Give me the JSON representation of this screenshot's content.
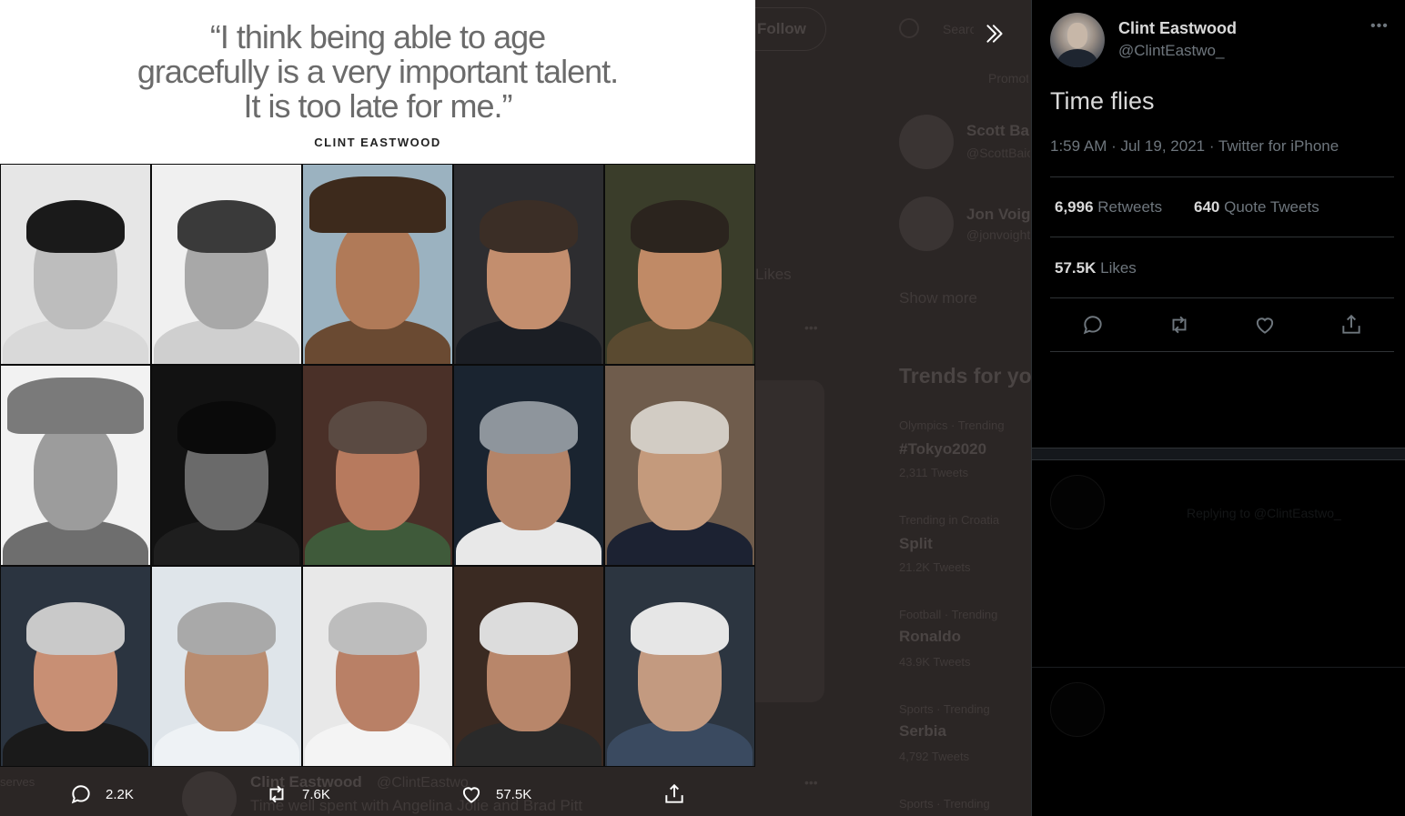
{
  "tweet": {
    "author": {
      "display_name": "Clint Eastwood",
      "handle": "@ClintEastwo_"
    },
    "text": "Time flies",
    "meta": "1:59 AM · Jul 19, 2021 · Twitter for iPhone",
    "retweets": {
      "count": "6,996",
      "label": "Retweets"
    },
    "quote_tweets": {
      "count": "640",
      "label": "Quote Tweets"
    },
    "likes": {
      "count": "57.5K",
      "label": "Likes"
    },
    "more_icon": "•••"
  },
  "media": {
    "quote_line1": "“I think being able to age",
    "quote_line2": "gracefully is a very important talent.",
    "quote_line3": "It is too late for me.”",
    "quote_attribution": "CLINT EASTWOOD",
    "actions": {
      "replies": "2.2K",
      "retweets": "7.6K",
      "likes": "57.5K"
    }
  },
  "background": {
    "follow_label": "Follow",
    "search_placeholder": "Search Twitter",
    "promoted": "Promoted",
    "who_to_follow": [
      {
        "name": "Scott Baio",
        "handle": "@ScottBaio"
      },
      {
        "name": "Jon Voight",
        "handle": "@jonvoight"
      }
    ],
    "show_more": "Show more",
    "likes_partial": "Likes",
    "trends_title": "Trends for you",
    "trends": [
      {
        "context": "Olympics · Trending",
        "name": "#Tokyo2020",
        "count": "2,311 Tweets"
      },
      {
        "context": "Trending in Croatia",
        "name": "Split",
        "count": "21.2K Tweets"
      },
      {
        "context": "Football · Trending",
        "name": "Ronaldo",
        "count": "43.9K Tweets"
      },
      {
        "context": "Sports · Trending",
        "name": "Serbia",
        "count": "4,792 Tweets"
      },
      {
        "context": "Sports · Trending",
        "name": "",
        "count": ""
      }
    ],
    "feed_author": "Clint Eastwood",
    "feed_handle": "@ClintEastwo_",
    "feed_text": "Time well spent with Angelina Jolie and Brad Pitt",
    "feed_left_label": "serves",
    "replying_to": "Replying to @ClintEastwo_"
  },
  "colors": {
    "accent": "#1da1f2",
    "overlay_bg": "#2b2625",
    "detail_bg": "#000000",
    "secondary_text": "#6e767d",
    "primary_text": "#d9d9d9"
  }
}
